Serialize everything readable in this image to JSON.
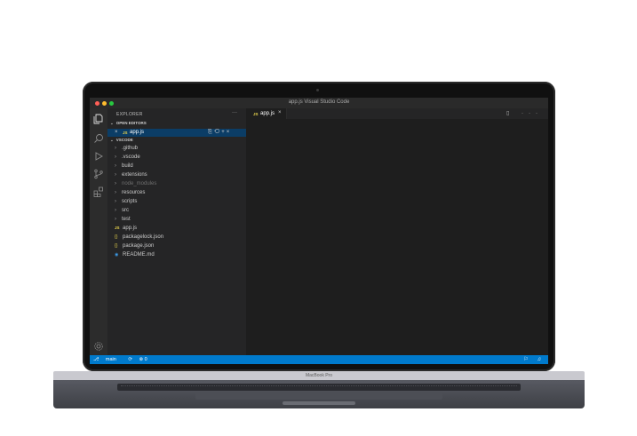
{
  "window": {
    "title": "app.js  Visual  Studio Code"
  },
  "sidebar": {
    "header": "EXPLORER",
    "more": "···",
    "open_editors_label": "OPEN EDITORS",
    "open_editor": {
      "close": "×",
      "badge": "JS",
      "name": "app.js"
    },
    "open_editor_actions": "⎘⟲+×",
    "workspace_label": "VSCODE",
    "items": [
      {
        "label": ".github",
        "chevron": "›"
      },
      {
        "label": ".vscode",
        "chevron": "›"
      },
      {
        "label": "build",
        "chevron": "›"
      },
      {
        "label": "extensions",
        "chevron": "›"
      },
      {
        "label": "node_modules",
        "chevron": "›"
      },
      {
        "label": "resources",
        "chevron": "›"
      },
      {
        "label": "scripts",
        "chevron": "›"
      },
      {
        "label": "src",
        "chevron": "›"
      },
      {
        "label": "test",
        "chevron": "›"
      },
      {
        "label": "app.js",
        "badge": "JS"
      },
      {
        "label": "packagelock.json",
        "badge": "{}"
      },
      {
        "label": "package.json",
        "badge": "{}"
      },
      {
        "label": "README.md",
        "badge": "◉"
      }
    ]
  },
  "editor": {
    "tab": {
      "badge": "JS",
      "name": "app.js",
      "close": "×"
    },
    "tools": "▯ ···"
  },
  "statusbar": {
    "branch": "main",
    "sync": "⟳",
    "problems": "⊗ 0",
    "right": "⚐ ♫"
  },
  "laptop": {
    "model": "MacBook Pro"
  },
  "colors": {
    "accent": "#007acc",
    "selection": "#0b3d66",
    "js": "#e8d44d"
  }
}
